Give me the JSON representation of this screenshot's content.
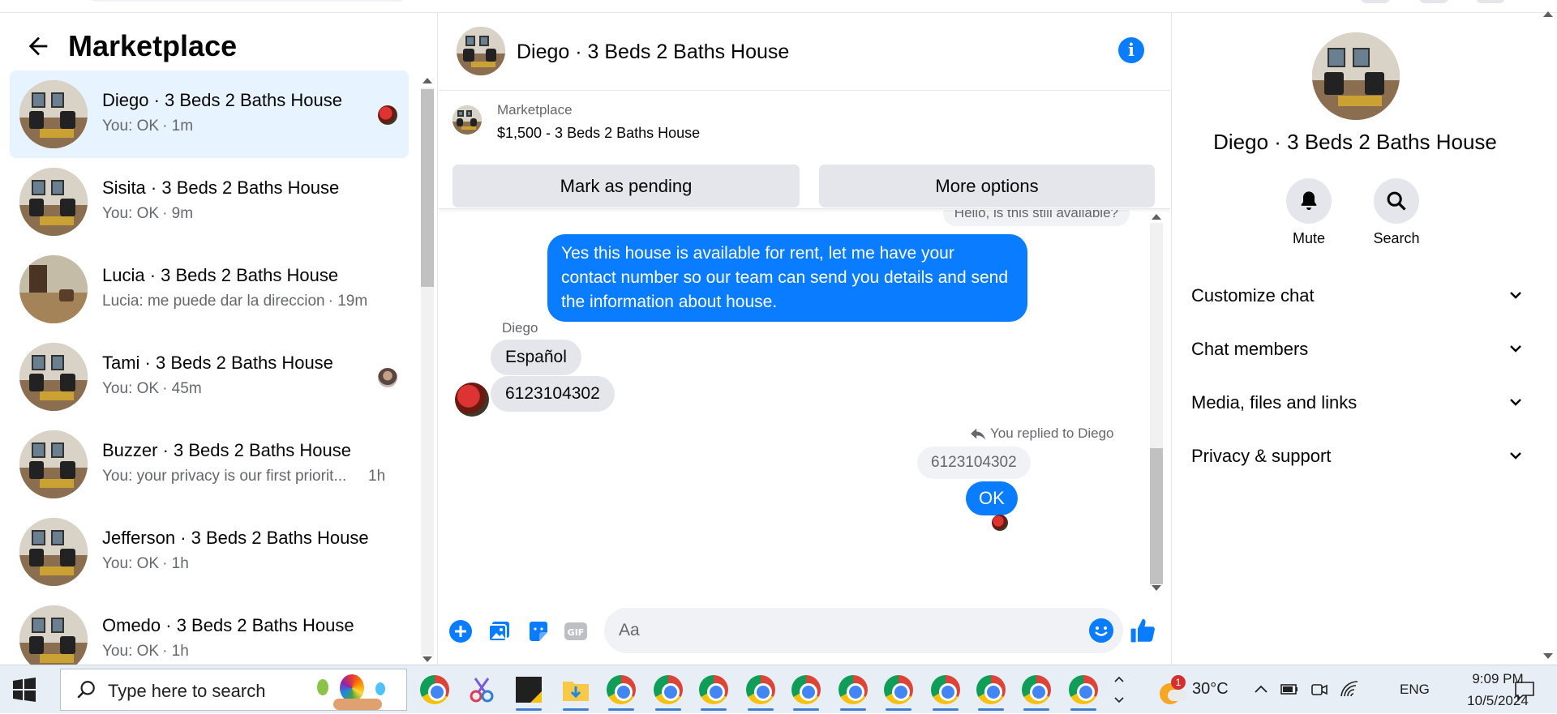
{
  "left": {
    "title": "Marketplace",
    "conversations": [
      {
        "name": "Diego · 3 Beds 2 Baths House",
        "preview": "You: OK",
        "time": "· 1m",
        "active": true,
        "seen": "red",
        "thumb": "house"
      },
      {
        "name": "Sisita · 3 Beds 2 Baths House",
        "preview": "You: OK",
        "time": "· 9m",
        "active": false,
        "seen": "",
        "thumb": "house"
      },
      {
        "name": "Lucia · 3 Beds 2 Baths House",
        "preview": "Lucia: me puede dar la direccion",
        "time": "· 19m",
        "active": false,
        "seen": "",
        "thumb": "interior"
      },
      {
        "name": "Tami · 3 Beds 2 Baths House",
        "preview": "You: OK",
        "time": "· 45m",
        "active": false,
        "seen": "person",
        "thumb": "house"
      },
      {
        "name": "Buzzer · 3 Beds 2 Baths House",
        "preview": "You: your privacy is our first priorit...",
        "time": "1h",
        "active": false,
        "seen": "",
        "thumb": "house"
      },
      {
        "name": "Jefferson · 3 Beds 2 Baths House",
        "preview": "You: OK",
        "time": "· 1h",
        "active": false,
        "seen": "",
        "thumb": "house"
      },
      {
        "name": "Omedo · 3 Beds 2 Baths House",
        "preview": "You: OK",
        "time": "· 1h",
        "active": false,
        "seen": "",
        "thumb": "house"
      }
    ]
  },
  "chat": {
    "title": "Diego · 3 Beds 2 Baths House",
    "marketplace_label": "Marketplace",
    "listing": "$1,500 - 3 Beds 2 Baths House",
    "btn_pending": "Mark as pending",
    "btn_more": "More options",
    "messages": {
      "top_quote": "Hello, is this still available?",
      "reply_main": "Yes this house is  available for rent, let me have your contact number so our team can send you details and send the information about house.",
      "sender": "Diego",
      "in1": "Español",
      "in2": "6123104302",
      "replied_label": "You replied to Diego",
      "quoted": "6123104302",
      "out_ok": "OK"
    },
    "input_placeholder": "Aa"
  },
  "right": {
    "name": "Diego · 3 Beds 2 Baths House",
    "mute": "Mute",
    "search": "Search",
    "sections": [
      "Customize chat",
      "Chat members",
      "Media, files and links",
      "Privacy & support"
    ]
  },
  "taskbar": {
    "search_placeholder": "Type here to search",
    "temperature": "30°C",
    "language": "ENG",
    "time": "9:09 PM",
    "date": "10/5/2024",
    "weather_badge": "1"
  },
  "colors": {
    "accent": "#0a7cff",
    "active_row": "#e7f3ff",
    "bubble_in": "#e4e6eb"
  }
}
